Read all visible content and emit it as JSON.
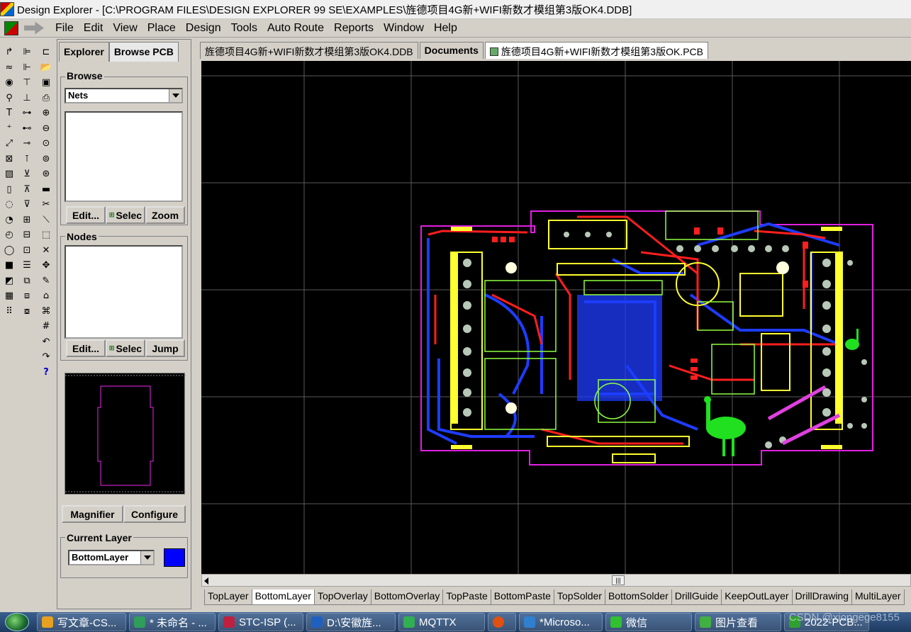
{
  "window": {
    "title": "Design Explorer - [C:\\PROGRAM FILES\\DESIGN EXPLORER 99 SE\\EXAMPLES\\旌德项目4G新+WIFI新数才模组第3版OK4.DDB]"
  },
  "menu": [
    "File",
    "Edit",
    "View",
    "Place",
    "Design",
    "Tools",
    "Auto Route",
    "Reports",
    "Window",
    "Help"
  ],
  "panel": {
    "tabs": [
      "Explorer",
      "Browse PCB"
    ],
    "browse_label": "Browse",
    "browse_select": "Nets",
    "browse_buttons": [
      "Edit...",
      "Selec",
      "Zoom"
    ],
    "nodes_label": "Nodes",
    "nodes_buttons": [
      "Edit...",
      "Selec",
      "Jump"
    ],
    "magnifier_button": "Magnifier",
    "configure_button": "Configure",
    "current_layer_label": "Current Layer",
    "current_layer_value": "BottomLayer",
    "current_layer_color": "#0000ff"
  },
  "doc_tabs": [
    {
      "label": "旌德项目4G新+WIFI新数才模组第3版OK4.DDB",
      "active": false
    },
    {
      "label": "Documents",
      "active": false
    },
    {
      "label": "旌德项目4G新+WIFI新数才模组第3版OK.PCB",
      "active": true
    }
  ],
  "layer_tabs": [
    "TopLayer",
    "BottomLayer",
    "TopOverlay",
    "BottomOverlay",
    "TopPaste",
    "BottomPaste",
    "TopSolder",
    "BottomSolder",
    "DrillGuide",
    "KeepOutLayer",
    "DrillDrawing",
    "MultiLayer"
  ],
  "active_layer_tab": "BottomLayer",
  "taskbar": [
    {
      "label": "写文章-CS...",
      "color": "#e8a020"
    },
    {
      "label": "* 未命名 - ...",
      "color": "#2f9e5a"
    },
    {
      "label": "STC-ISP (...",
      "color": "#c02040"
    },
    {
      "label": "D:\\安徽旌...",
      "color": "#2060c0"
    },
    {
      "label": "MQTTX",
      "color": "#30b050"
    },
    {
      "label": "",
      "color": "#e05010"
    },
    {
      "label": "*Microso...",
      "color": "#3080d0"
    },
    {
      "label": "微信",
      "color": "#30c030"
    },
    {
      "label": "图片查看",
      "color": "#40b040"
    },
    {
      "label": "2022-PCB...",
      "color": "#30a030"
    }
  ],
  "watermark": "CSDN @xiongege8155"
}
